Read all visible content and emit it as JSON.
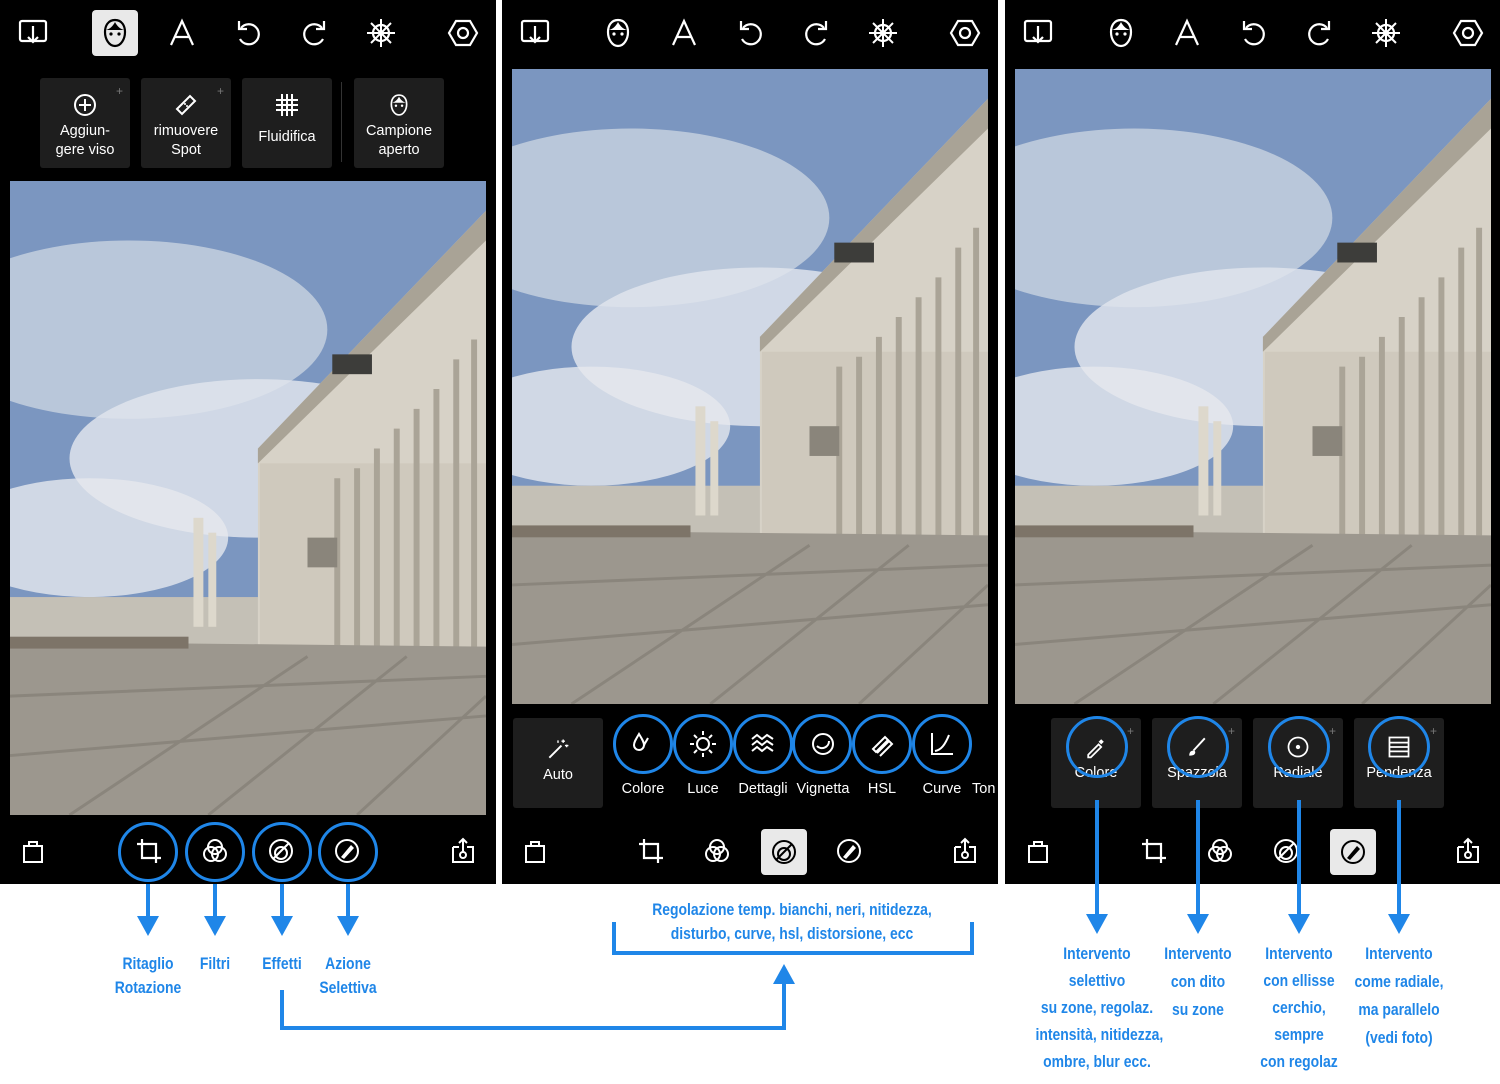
{
  "accent_color": "#1f86e8",
  "screen1": {
    "tools": [
      {
        "label_line1": "Aggiun-",
        "label_line2": "gere viso",
        "icon": "add-face-icon"
      },
      {
        "label_line1": "rimuovere",
        "label_line2": "Spot",
        "icon": "bandage-icon"
      },
      {
        "label_line1": "Fluidifica",
        "label_line2": "",
        "icon": "grid-warp-icon"
      },
      {
        "label_line1": "Campione",
        "label_line2": "aperto",
        "icon": "face-icon"
      }
    ]
  },
  "screen2": {
    "adjustments": {
      "auto": "Auto",
      "items": [
        "Colore",
        "Luce",
        "Dettagli",
        "Vignetta",
        "HSL",
        "Curve",
        "Ton"
      ]
    }
  },
  "screen3": {
    "selective_tools": [
      "Colore",
      "Spazzola",
      "Radiale",
      "Pendenza"
    ]
  },
  "annotations": {
    "crop": [
      "Ritaglio",
      "Rotazione"
    ],
    "filters": "Filtri",
    "effects": "Effetti",
    "selective": [
      "Azione",
      "Selettiva"
    ],
    "adjust_note": [
      "Regolazione temp. bianchi, neri, nitidezza,",
      "disturbo, curve, hsl, distorsione, ecc"
    ],
    "color_note": [
      "Intervento",
      "selettivo",
      "su zone, regolaz.",
      "intensità, nitidezza,",
      "ombre, blur ecc."
    ],
    "brush_note": [
      "Intervento",
      "con dito",
      "su zone"
    ],
    "radial_note": [
      "Intervento",
      "con ellisse",
      "cerchio,",
      "sempre",
      "con regolaz"
    ],
    "gradient_note": [
      "Intervento",
      "come radiale,",
      "ma parallelo",
      "(vedi foto)"
    ]
  }
}
